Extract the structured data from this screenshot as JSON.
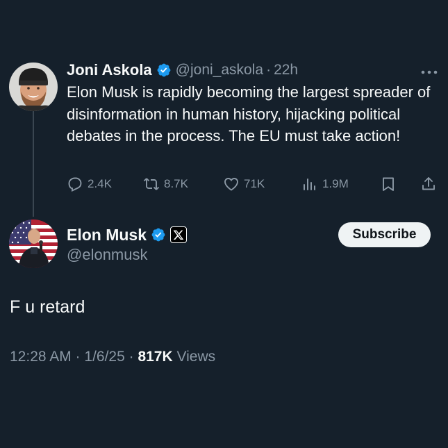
{
  "parent_tweet": {
    "author_name": "Joni Askola",
    "handle": "@joni_askola",
    "separator": "·",
    "time": "22h",
    "text": "Elon Musk is rapidly becoming the largest spreader of disinformation in human history, hijacking political debates in the process. The EU must take action!",
    "stats": {
      "replies": "2.4K",
      "retweets": "8.7K",
      "likes": "71K",
      "views": "1.9M"
    },
    "avatar_icon": "bearded-man-beanie-avatar"
  },
  "reply": {
    "author_name": "Elon Musk",
    "handle": "@elonmusk",
    "subscribe_label": "Subscribe",
    "text": "F u retard",
    "timestamp": "12:28 AM · 1/6/25 · ",
    "views_count": "817K",
    "views_label": " Views",
    "avatar_icon": "man-flag-background-avatar"
  },
  "colors": {
    "background": "#15202b",
    "text_primary": "#f7f9f9",
    "text_secondary": "#8b98a5",
    "verified_blue": "#1d9bf0",
    "thread_line": "#3a4651"
  }
}
